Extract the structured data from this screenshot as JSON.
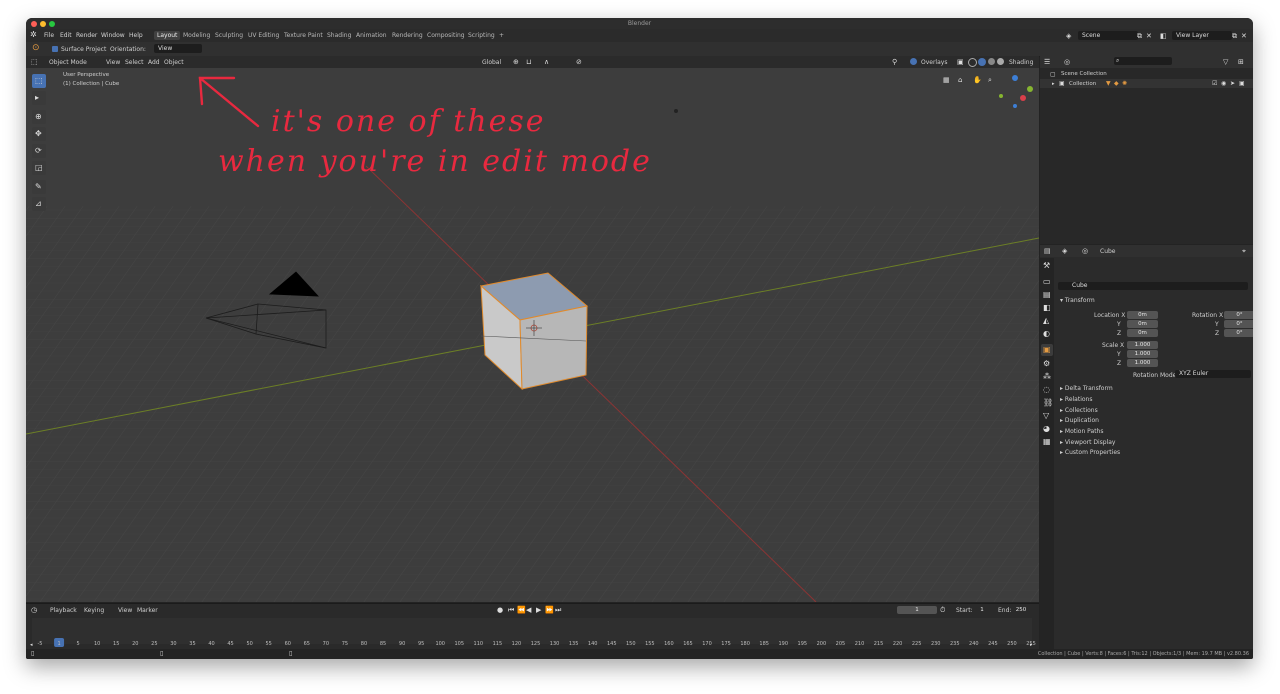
{
  "window": {
    "title": "Blender",
    "colors": {
      "close": "#fe5f57",
      "min": "#febc2e",
      "max": "#28c840"
    }
  },
  "menu": [
    "File",
    "Edit",
    "Render",
    "Window",
    "Help"
  ],
  "workspaces": [
    "Layout",
    "Modeling",
    "Sculpting",
    "UV Editing",
    "Texture Paint",
    "Shading",
    "Animation",
    "Rendering",
    "Compositing",
    "Scripting",
    "+"
  ],
  "active_workspace": "Layout",
  "scene": {
    "name": "Scene",
    "view_layer": "View Layer"
  },
  "tool_settings": {
    "surface_project": "Surface Project",
    "orientation_label": "Orientation:",
    "orientation_value": "View"
  },
  "viewport_header": {
    "mode": "Object Mode",
    "view": "View",
    "select": "Select",
    "add": "Add",
    "object": "Object",
    "transform": "Global",
    "overlays": "Overlays",
    "shading": "Shading"
  },
  "viewport": {
    "perspective": "User Perspective",
    "collection_info": "(1) Collection | Cube"
  },
  "annotation": {
    "line1": "it's one of these",
    "line2": "when you're in edit mode",
    "color": "#e8293f"
  },
  "outliner": {
    "root": "Scene Collection",
    "collection": "Collection"
  },
  "properties": {
    "object_name": "Cube",
    "data_name": "Cube",
    "transform_label": "Transform",
    "location": {
      "label": "Location X",
      "x": "0m",
      "y": "0m",
      "z": "0m"
    },
    "rotation": {
      "label": "Rotation X",
      "x": "0°",
      "y": "0°",
      "z": "0°"
    },
    "scale": {
      "label": "Scale X",
      "x": "1.000",
      "y": "1.000",
      "z": "1.000"
    },
    "axis": {
      "y": "Y",
      "z": "Z"
    },
    "rotation_mode_label": "Rotation Mode",
    "rotation_mode_value": "XYZ Euler",
    "sections": [
      "Delta Transform",
      "Relations",
      "Collections",
      "Duplication",
      "Motion Paths",
      "Viewport Display",
      "Custom Properties"
    ]
  },
  "timeline": {
    "playback": "Playback",
    "keying": "Keying",
    "view": "View",
    "marker": "Marker",
    "current_frame": "1",
    "start_label": "Start:",
    "start": "1",
    "end_label": "End:",
    "end": "250",
    "ruler": [
      "-5",
      "1",
      "5",
      "10",
      "15",
      "20",
      "25",
      "30",
      "35",
      "40",
      "45",
      "50",
      "55",
      "60",
      "65",
      "70",
      "75",
      "80",
      "85",
      "90",
      "95",
      "100",
      "105",
      "110",
      "115",
      "120",
      "125",
      "130",
      "135",
      "140",
      "145",
      "150",
      "155",
      "160",
      "165",
      "170",
      "175",
      "180",
      "185",
      "190",
      "195",
      "200",
      "205",
      "210",
      "215",
      "220",
      "225",
      "230",
      "235",
      "240",
      "245",
      "250",
      "255"
    ]
  },
  "statusbar": "Collection | Cube | Verts:8 | Faces:6 | Tris:12 | Objects:1/3 | Mem: 19.7 MB | v2.80.36"
}
